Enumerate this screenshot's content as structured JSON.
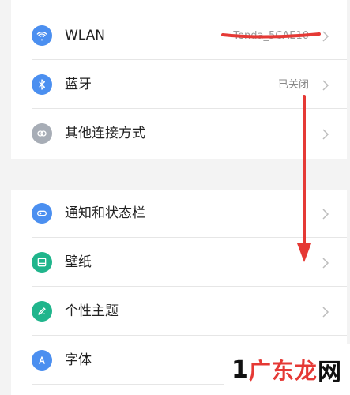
{
  "settings": {
    "group1": [
      {
        "label": "WLAN",
        "value": "Tenda_5CAE10",
        "icon": "wifi-icon",
        "color": "#4b8ff0"
      },
      {
        "label": "蓝牙",
        "value": "已关闭",
        "icon": "bluetooth-icon",
        "color": "#4b8ff0"
      },
      {
        "label": "其他连接方式",
        "value": "",
        "icon": "link-icon",
        "color": "#a7adb6"
      }
    ],
    "group2": [
      {
        "label": "通知和状态栏",
        "icon": "toggle-icon",
        "color": "#4b8ff0"
      },
      {
        "label": "壁纸",
        "icon": "wallpaper-icon",
        "color": "#20b58c"
      },
      {
        "label": "个性主题",
        "icon": "theme-brush-icon",
        "color": "#20b58c"
      },
      {
        "label": "字体",
        "icon": "font-icon",
        "color": "#4b8ff0"
      }
    ]
  },
  "watermark": {
    "text_black": "1",
    "text_red": "广东龙",
    "text_black2": "网"
  },
  "colors": {
    "annotation_red": "#e53935",
    "divider": "#e6e6e6"
  }
}
